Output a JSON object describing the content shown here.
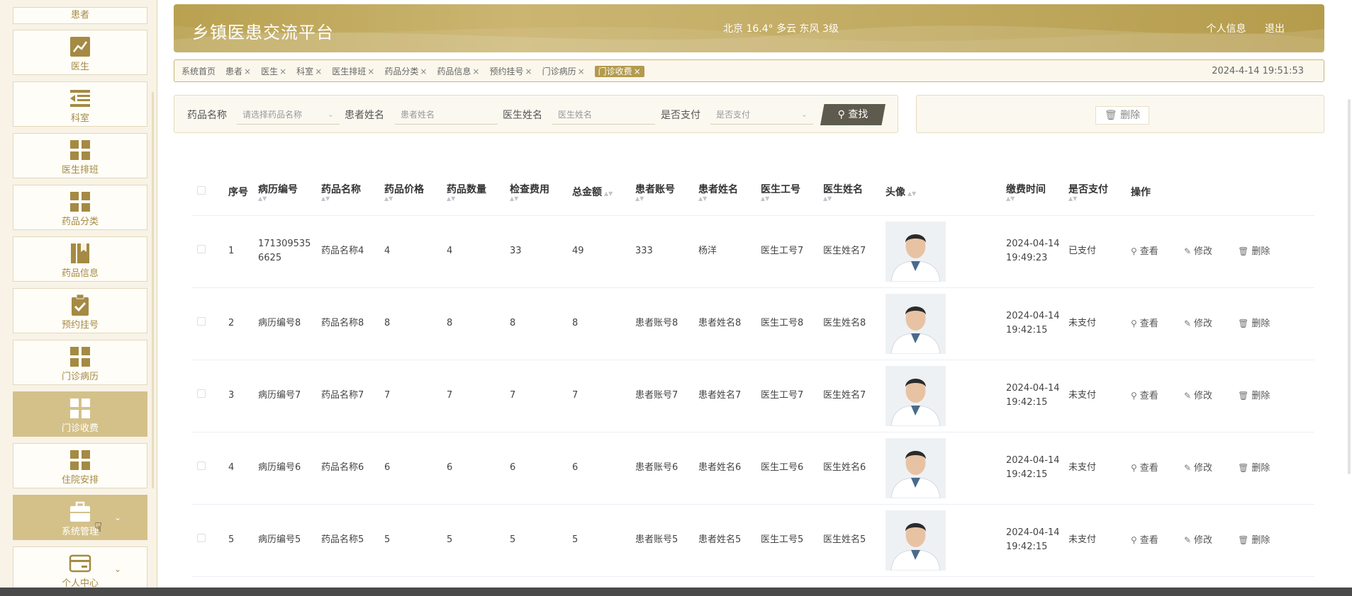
{
  "sidebar": {
    "top_label": "患者",
    "items": [
      {
        "label": "医生",
        "icon": "chart-line-icon",
        "active": false
      },
      {
        "label": "科室",
        "icon": "list-icon",
        "active": false
      },
      {
        "label": "医生排班",
        "icon": "grid-icon",
        "active": false
      },
      {
        "label": "药品分类",
        "icon": "grid-icon",
        "active": false
      },
      {
        "label": "药品信息",
        "icon": "book-icon",
        "active": false
      },
      {
        "label": "预约挂号",
        "icon": "clipboard-check-icon",
        "active": false
      },
      {
        "label": "门诊病历",
        "icon": "grid-icon",
        "active": false
      },
      {
        "label": "门诊收费",
        "icon": "grid-icon",
        "active": true
      },
      {
        "label": "住院安排",
        "icon": "grid-icon",
        "active": false
      },
      {
        "label": "系统管理",
        "icon": "briefcase-icon",
        "active": false
      },
      {
        "label": "个人中心",
        "icon": "card-icon",
        "active": false
      }
    ]
  },
  "header": {
    "title": "乡镇医患交流平台",
    "weather": "北京  16.4°  多云  东风  3级",
    "profile_link": "个人信息",
    "logout_link": "退出"
  },
  "tabs": [
    {
      "label": "系统首页",
      "closable": false,
      "active": false
    },
    {
      "label": "患者",
      "closable": true,
      "active": false
    },
    {
      "label": "医生",
      "closable": true,
      "active": false
    },
    {
      "label": "科室",
      "closable": true,
      "active": false
    },
    {
      "label": "医生排班",
      "closable": true,
      "active": false
    },
    {
      "label": "药品分类",
      "closable": true,
      "active": false
    },
    {
      "label": "药品信息",
      "closable": true,
      "active": false
    },
    {
      "label": "预约挂号",
      "closable": true,
      "active": false
    },
    {
      "label": "门诊病历",
      "closable": true,
      "active": false
    },
    {
      "label": "门诊收费",
      "closable": true,
      "active": true
    }
  ],
  "clock": "2024-4-14 19:51:53",
  "search": {
    "drug_label": "药品名称",
    "drug_placeholder": "请选择药品名称",
    "patient_label": "患者姓名",
    "patient_placeholder": "患者姓名",
    "doctor_label": "医生姓名",
    "doctor_placeholder": "医生姓名",
    "paid_label": "是否支付",
    "paid_placeholder": "是否支付",
    "button": "查找"
  },
  "actions": {
    "delete": "删除"
  },
  "table": {
    "headers": {
      "index": "序号",
      "record_no": "病历编号",
      "drug_name": "药品名称",
      "drug_price": "药品价格",
      "drug_qty": "药品数量",
      "exam_fee": "检查费用",
      "total": "总金额",
      "patient_account": "患者账号",
      "patient_name": "患者姓名",
      "doctor_no": "医生工号",
      "doctor_name": "医生姓名",
      "avatar": "头像",
      "pay_time": "缴费时间",
      "paid": "是否支付",
      "ops": "操作"
    },
    "op_labels": {
      "view": "查看",
      "edit": "修改",
      "delete": "删除"
    },
    "rows": [
      {
        "index": "1",
        "record_no": "1713095356625",
        "drug_name": "药品名称4",
        "drug_price": "4",
        "drug_qty": "4",
        "exam_fee": "33",
        "total": "49",
        "patient_account": "333",
        "patient_name": "杨洋",
        "doctor_no": "医生工号7",
        "doctor_name": "医生姓名7",
        "pay_time": "2024-04-14 19:49:23",
        "paid": "已支付"
      },
      {
        "index": "2",
        "record_no": "病历编号8",
        "drug_name": "药品名称8",
        "drug_price": "8",
        "drug_qty": "8",
        "exam_fee": "8",
        "total": "8",
        "patient_account": "患者账号8",
        "patient_name": "患者姓名8",
        "doctor_no": "医生工号8",
        "doctor_name": "医生姓名8",
        "pay_time": "2024-04-14 19:42:15",
        "paid": "未支付"
      },
      {
        "index": "3",
        "record_no": "病历编号7",
        "drug_name": "药品名称7",
        "drug_price": "7",
        "drug_qty": "7",
        "exam_fee": "7",
        "total": "7",
        "patient_account": "患者账号7",
        "patient_name": "患者姓名7",
        "doctor_no": "医生工号7",
        "doctor_name": "医生姓名7",
        "pay_time": "2024-04-14 19:42:15",
        "paid": "未支付"
      },
      {
        "index": "4",
        "record_no": "病历编号6",
        "drug_name": "药品名称6",
        "drug_price": "6",
        "drug_qty": "6",
        "exam_fee": "6",
        "total": "6",
        "patient_account": "患者账号6",
        "patient_name": "患者姓名6",
        "doctor_no": "医生工号6",
        "doctor_name": "医生姓名6",
        "pay_time": "2024-04-14 19:42:15",
        "paid": "未支付"
      },
      {
        "index": "5",
        "record_no": "病历编号5",
        "drug_name": "药品名称5",
        "drug_price": "5",
        "drug_qty": "5",
        "exam_fee": "5",
        "total": "5",
        "patient_account": "患者账号5",
        "patient_name": "患者姓名5",
        "doctor_no": "医生工号5",
        "doctor_name": "医生姓名5",
        "pay_time": "2024-04-14 19:42:15",
        "paid": "未支付"
      }
    ]
  },
  "colors": {
    "accent": "#b39a4c",
    "sidebar_active": "#d4c18a",
    "search_button": "#5e5a4d"
  }
}
